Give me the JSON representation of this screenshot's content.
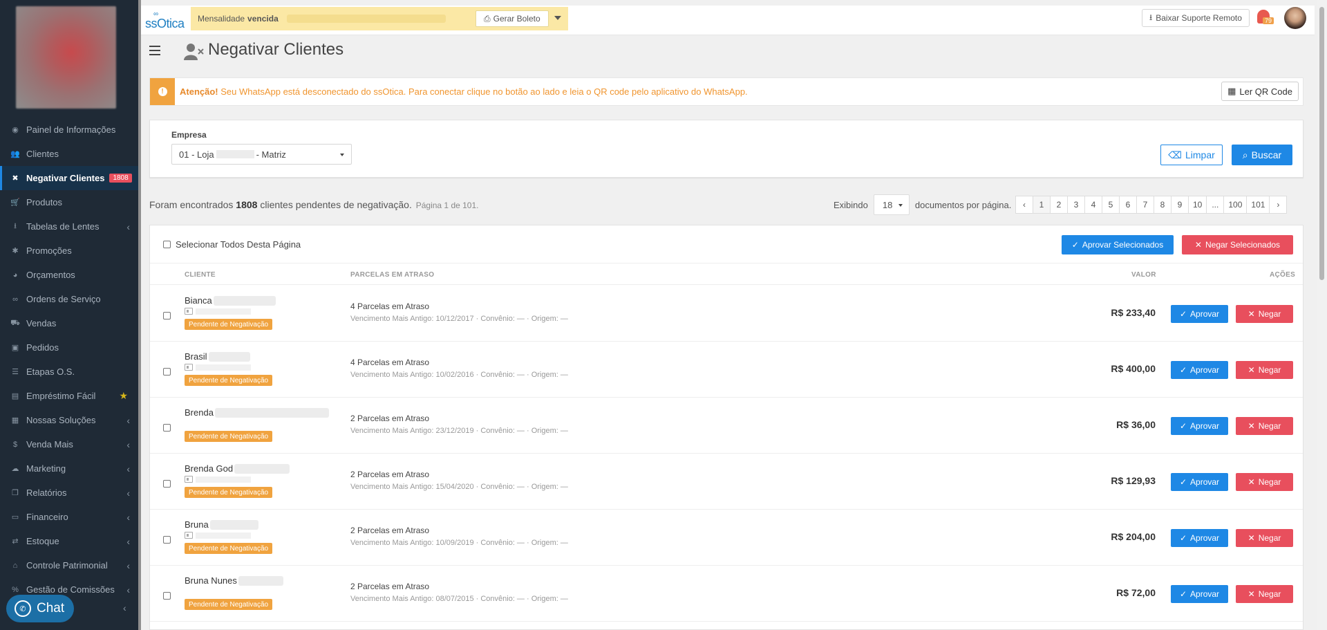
{
  "sidebar": {
    "items": [
      {
        "label": "Painel de Informações",
        "icon": "dashboard-icon",
        "glyph": "◉",
        "chevron": false
      },
      {
        "label": "Clientes",
        "icon": "users-icon",
        "glyph": "👥",
        "chevron": false
      },
      {
        "label": "Negativar Clientes",
        "icon": "user-x-icon",
        "glyph": "✖",
        "chevron": false,
        "active": true,
        "badge": "1808"
      },
      {
        "label": "Produtos",
        "icon": "cart-icon",
        "glyph": "🛒",
        "chevron": false
      },
      {
        "label": "Tabelas de Lentes",
        "icon": "download-icon",
        "glyph": "⭳",
        "chevron": true
      },
      {
        "label": "Promoções",
        "icon": "asterisk-icon",
        "glyph": "✱",
        "chevron": false
      },
      {
        "label": "Orçamentos",
        "icon": "chat-icon",
        "glyph": "◕",
        "chevron": false
      },
      {
        "label": "Ordens de Serviço",
        "icon": "glasses-icon",
        "glyph": "∞",
        "chevron": false
      },
      {
        "label": "Vendas",
        "icon": "basket-icon",
        "glyph": "⛟",
        "chevron": false
      },
      {
        "label": "Pedidos",
        "icon": "inbox-icon",
        "glyph": "▣",
        "chevron": false
      },
      {
        "label": "Etapas O.S.",
        "icon": "list-icon",
        "glyph": "☰",
        "chevron": false
      },
      {
        "label": "Empréstimo Fácil",
        "icon": "document-icon",
        "glyph": "▤",
        "chevron": false,
        "star": true
      },
      {
        "label": "Nossas Soluções",
        "icon": "briefcase-icon",
        "glyph": "▦",
        "chevron": true
      },
      {
        "label": "Venda Mais",
        "icon": "dollar-icon",
        "glyph": "$",
        "chevron": true
      },
      {
        "label": "Marketing",
        "icon": "comments-icon",
        "glyph": "☁",
        "chevron": true
      },
      {
        "label": "Relatórios",
        "icon": "copy-icon",
        "glyph": "❐",
        "chevron": true
      },
      {
        "label": "Financeiro",
        "icon": "money-icon",
        "glyph": "▭",
        "chevron": true
      },
      {
        "label": "Estoque",
        "icon": "exchange-icon",
        "glyph": "⇄",
        "chevron": true
      },
      {
        "label": "Controle Patrimonial",
        "icon": "building-icon",
        "glyph": "⌂",
        "chevron": true
      },
      {
        "label": "Gestão de Comissões",
        "icon": "percent-icon",
        "glyph": "%",
        "chevron": true
      }
    ],
    "chat_label": "Chat",
    "star_glyph": "★",
    "chevron_glyph": "‹"
  },
  "topbar": {
    "brand": "ssOtica",
    "warning_prefix": "Mensalidade",
    "warning_bold": "vencida",
    "boleto_label": "Gerar Boleto",
    "suporte_label": "Baixar Suporte Remoto",
    "notif_count": "79"
  },
  "page": {
    "title": "Negativar Clientes"
  },
  "alert": {
    "bold": "Atenção!",
    "message": "Seu WhatsApp está desconectado do ssOtica. Para conectar clique no botão ao lado e leia o QR code pelo aplicativo do WhatsApp.",
    "qr_label": "Ler QR Code"
  },
  "filter": {
    "empresa_label": "Empresa",
    "empresa_prefix": "01 - Loja",
    "empresa_suffix": "- Matriz",
    "limpar_label": "Limpar",
    "buscar_label": "Buscar"
  },
  "summary": {
    "prefix": "Foram encontrados",
    "count": "1808",
    "suffix": "clientes pendentes de negativação.",
    "page_info": "Página 1 de 101.",
    "exibindo": "Exibindo",
    "per_page": "18",
    "docs_label": "documentos por página."
  },
  "pagination": [
    "‹",
    "1",
    "2",
    "3",
    "4",
    "5",
    "6",
    "7",
    "8",
    "9",
    "10",
    "...",
    "100",
    "101",
    "›"
  ],
  "table": {
    "select_all": "Selecionar Todos Desta Página",
    "aprovar_sel": "Aprovar Selecionados",
    "negar_sel": "Negar Selecionados",
    "headers": {
      "cliente": "CLIENTE",
      "parcelas": "PARCELAS EM ATRASO",
      "valor": "VALOR",
      "acoes": "AÇÕES"
    },
    "tag_label": "Pendente de Negativação",
    "parcelas_suffix": "em Atraso",
    "aprovar": "Aprovar",
    "negar": "Negar",
    "rows": [
      {
        "name": "Bianca",
        "count": "4 Parcelas",
        "venc": "Vencimento Mais Antigo: 10/12/2017 · Convênio: — · Origem: —",
        "valor": "R$ 233,40",
        "idcard": true
      },
      {
        "name": "Brasil",
        "count": "4 Parcelas",
        "venc": "Vencimento Mais Antigo: 10/02/2016 · Convênio: — · Origem: —",
        "valor": "R$ 400,00",
        "idcard": true
      },
      {
        "name": "Brenda",
        "count": "2 Parcelas",
        "venc": "Vencimento Mais Antigo: 23/12/2019 · Convênio: — · Origem: —",
        "valor": "R$ 36,00",
        "idcard": false
      },
      {
        "name": "Brenda God",
        "count": "2 Parcelas",
        "venc": "Vencimento Mais Antigo: 15/04/2020 · Convênio: — · Origem: —",
        "valor": "R$ 129,93",
        "idcard": true
      },
      {
        "name": "Bruna",
        "count": "2 Parcelas",
        "venc": "Vencimento Mais Antigo: 10/09/2019 · Convênio: — · Origem: —",
        "valor": "R$ 204,00",
        "idcard": true
      },
      {
        "name": "Bruna Nunes",
        "count": "2 Parcelas",
        "venc": "Vencimento Mais Antigo: 08/07/2015 · Convênio: — · Origem: —",
        "valor": "R$ 72,00",
        "idcard": false
      }
    ]
  },
  "colors": {
    "primary": "#1e88e5",
    "danger": "#e84f5d",
    "warning": "#f0a33f",
    "sidebar_bg": "#1f2a36"
  }
}
